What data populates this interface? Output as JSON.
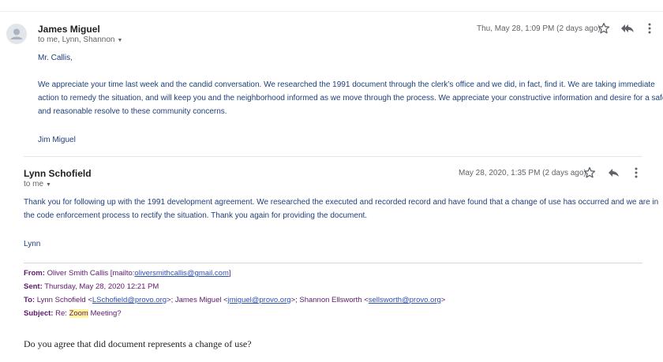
{
  "email1": {
    "sender": "James Miguel",
    "recipients": "to me, Lynn, Shannon",
    "date": "Thu, May 28, 1:09 PM (2 days ago)",
    "greeting": "Mr. Callis,",
    "body_lines": [
      "We appreciate your time last week and the candid conversation. We researched the 1991 document through the clerk’s office and we did, in fact, find it. We are taking immediate",
      "action to remedy the situation, and will keep you and the neighborhood informed as we move through the process. We appreciate your constructive information and desire for a safe",
      "and reasonable resolve to these community concerns."
    ],
    "signature": "Jim Miguel"
  },
  "email2": {
    "sender": "Lynn Schofield",
    "recipients": "to me",
    "date": "May 28, 2020, 1:35 PM (2 days ago)",
    "body_lines": [
      "Thank you for following up with the 1991 development agreement.  We researched the executed and recorded record and have found that a change of use has occurred and we are in",
      "the code enforcement process to rectify the situation.  Thank you again for providing the document."
    ],
    "signature": "Lynn"
  },
  "quoted": {
    "from_label": "From:",
    "from_name": "Oliver Smith Callis [mailto:",
    "from_email": "oliversmithcallis@gmail.com",
    "from_close": "]",
    "sent_label": "Sent:",
    "sent_value": "Thursday, May 28, 2020 12:21 PM",
    "to_label": "To:",
    "to_1_name": "Lynn Schofield <",
    "to_1_email": "LSchofield@provo.org",
    "to_2_name": ">; James Miguel <",
    "to_2_email": "jmiguel@provo.org",
    "to_3_name": ">; Shannon Ellsworth <",
    "to_3_email": "sellsworth@provo.org",
    "to_close": ">",
    "subject_label": "Subject:",
    "subject_pre": "Re: ",
    "subject_highlight": "Zoom",
    "subject_post": " Meeting?",
    "question": "Do you agree that did document represents a change of use?"
  },
  "icons": [
    "person-avatar-icon",
    "star-icon",
    "reply-all-icon",
    "reply-icon",
    "more-vert-icon",
    "caret-down-icon"
  ]
}
